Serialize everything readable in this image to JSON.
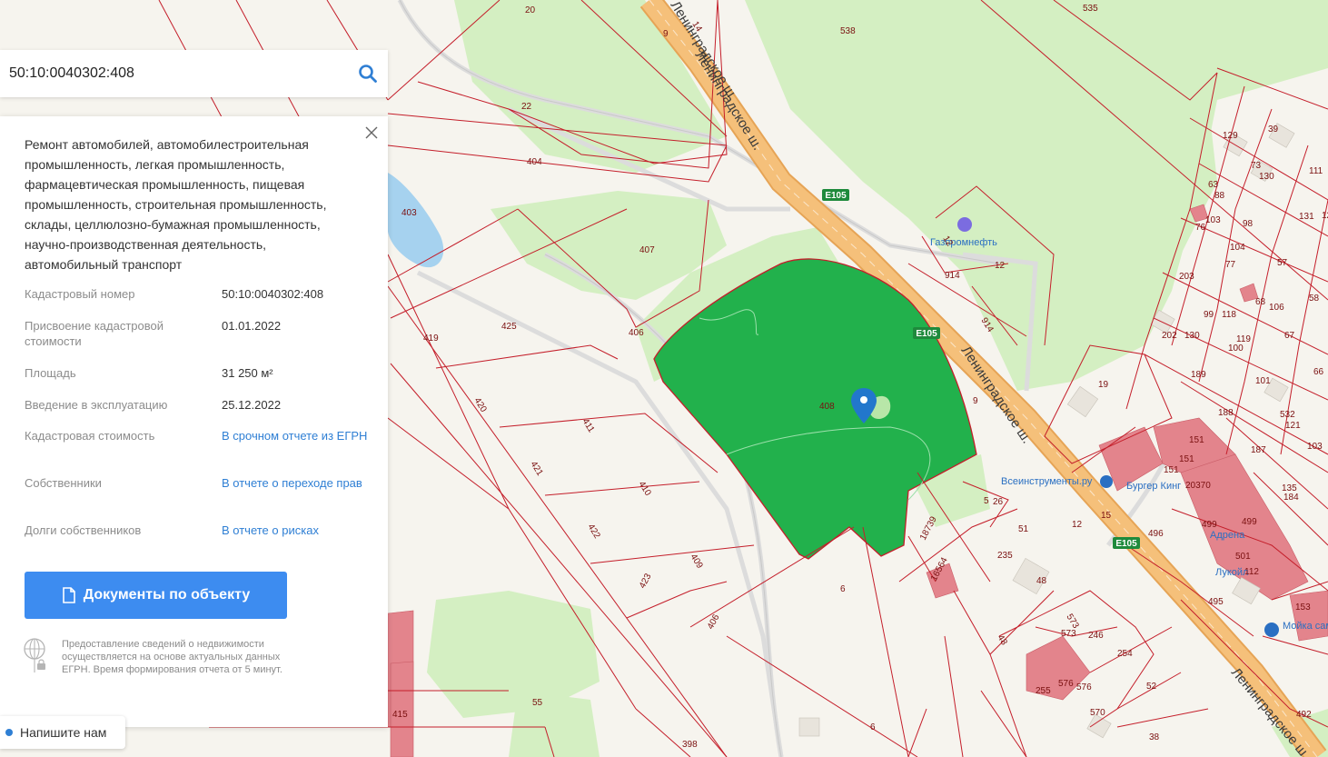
{
  "search": {
    "value": "50:10:0040302:408"
  },
  "info": {
    "description": "Ремонт автомобилей, автомобилестроительная промышленность, легкая промышленность, фармацевтическая промышленность, пищевая промышленность, строительная промышленность, склады, целлюлозно-бумажная промышленность, научно-производственная деятельность, автомобильный транспорт",
    "rows": [
      {
        "label": "Кадастровый номер",
        "value": "50:10:0040302:408",
        "link": false
      },
      {
        "label": "Присвоение кадастровой стоимости",
        "value": "01.01.2022",
        "link": false
      },
      {
        "label": "Площадь",
        "value": "31 250 м²",
        "link": false
      },
      {
        "label": "Введение в эксплуатацию",
        "value": "25.12.2022",
        "link": false
      },
      {
        "label": "Кадастровая стоимость",
        "value": "В срочном отчете из ЕГРН",
        "link": true
      },
      {
        "label": "Собственники",
        "value": "В отчете о переходе прав",
        "link": true
      },
      {
        "label": "Долги собственников",
        "value": "В отчете о рисках",
        "link": true
      }
    ],
    "documents_button": "Документы по объекту",
    "footnote": "Предоставление сведений о недвижимости осуществляется на основе актуальных данных ЕГРН. Время формирования отчета от 5 минут."
  },
  "chat": {
    "label": "Напишите нам"
  },
  "map": {
    "selected_parcel": "408",
    "road_name": "Ленинградское ш.",
    "route_badge": "E105",
    "poi": [
      "Газпромнефть",
      "Всеинструменты.ру",
      "Бургер Кинг",
      "Мойка самообслуживания",
      "Лукойл",
      "Адрена"
    ],
    "parcel_numbers": [
      "20",
      "22",
      "538",
      "535",
      "9",
      "14",
      "404",
      "403",
      "407",
      "425",
      "406",
      "419",
      "420",
      "411",
      "421",
      "410",
      "422",
      "409",
      "423",
      "406",
      "6",
      "6",
      "408",
      "9",
      "12",
      "12",
      "914",
      "914",
      "18739",
      "16564",
      "5",
      "26",
      "51",
      "235",
      "48",
      "48",
      "573",
      "573",
      "246",
      "254",
      "52",
      "570",
      "576",
      "576",
      "255",
      "38",
      "398",
      "55",
      "19",
      "12",
      "15",
      "496",
      "151",
      "151",
      "151",
      "20370",
      "499",
      "499",
      "501",
      "112",
      "495",
      "153",
      "129",
      "39",
      "73",
      "130",
      "111",
      "63",
      "88",
      "103",
      "76",
      "98",
      "131",
      "127",
      "104",
      "77",
      "57",
      "203",
      "99",
      "118",
      "68",
      "58",
      "106",
      "202",
      "130",
      "100",
      "119",
      "67",
      "66",
      "189",
      "101",
      "188",
      "532",
      "121",
      "187",
      "103",
      "135",
      "184",
      "492",
      "415"
    ],
    "colors": {
      "parcel_border": "#c41e2a",
      "selected_fill": "#22b14c",
      "forest": "#d4efc2",
      "water": "#a6d2ef",
      "building_fill": "#e3848c",
      "highway": "#f5c07a",
      "accent": "#3d8cf0"
    }
  }
}
